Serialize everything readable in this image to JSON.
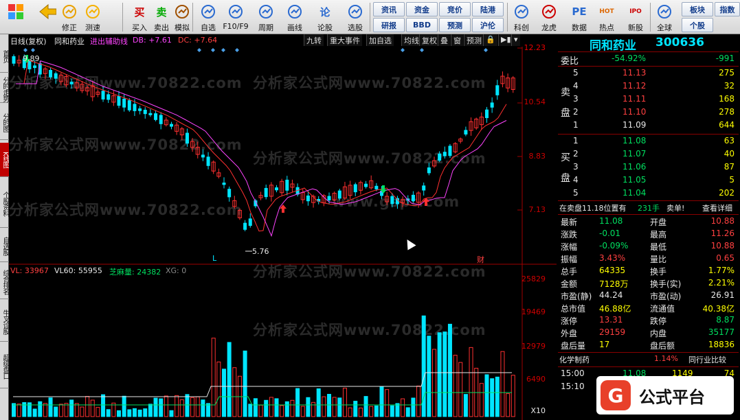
{
  "toolbar": {
    "items": [
      {
        "label": "",
        "icon": "grid-icon",
        "name": "toolbar-grid"
      },
      {
        "label": "",
        "icon": "back-arrow-icon",
        "name": "toolbar-back"
      },
      {
        "label": "修正",
        "icon": "up-down-icon",
        "name": "toolbar-fix"
      },
      {
        "label": "测速",
        "icon": "speed-icon",
        "name": "toolbar-speed"
      },
      {
        "label": "买入",
        "icon": "buy-icon",
        "glyph": "买",
        "name": "toolbar-buy"
      },
      {
        "label": "卖出",
        "icon": "sell-icon",
        "glyph": "卖",
        "name": "toolbar-sell"
      },
      {
        "label": "模拟",
        "icon": "hammer-icon",
        "name": "toolbar-simulate"
      },
      {
        "label": "自选",
        "icon": "star-list-icon",
        "name": "toolbar-watchlist"
      },
      {
        "label": "F10/F9",
        "icon": "f10-icon",
        "name": "toolbar-f10"
      },
      {
        "label": "周期",
        "icon": "clock-icon",
        "name": "toolbar-period"
      },
      {
        "label": "画线",
        "icon": "pencil-icon",
        "name": "toolbar-draw"
      },
      {
        "label": "论股",
        "icon": "discuss-icon",
        "glyph": "论",
        "name": "toolbar-discuss"
      },
      {
        "label": "选股",
        "icon": "select-stock-icon",
        "name": "toolbar-select"
      },
      {
        "label": "科创",
        "icon": "chart-icon",
        "name": "toolbar-star-market"
      },
      {
        "label": "龙虎",
        "icon": "dragon-icon",
        "name": "toolbar-dragon-tiger"
      },
      {
        "label": "数据",
        "icon": "pe-icon",
        "glyph": "PE",
        "name": "toolbar-data"
      },
      {
        "label": "热点",
        "icon": "hot-icon",
        "glyph": "HOT",
        "name": "toolbar-hot"
      },
      {
        "label": "新股",
        "icon": "ipo-icon",
        "glyph": "IPO",
        "name": "toolbar-ipo"
      },
      {
        "label": "全球",
        "icon": "globe-icon",
        "name": "toolbar-global"
      }
    ],
    "small_buttons": [
      "资讯",
      "资金",
      "竞价",
      "陆港",
      "研报",
      "BBD",
      "预测",
      "沪伦",
      "板块",
      "个股",
      "指数"
    ]
  },
  "left_tabs": [
    {
      "label": "首页",
      "active": false
    },
    {
      "label": "分时走势",
      "active": false
    },
    {
      "label": "分时图",
      "active": false
    },
    {
      "label": "K线图",
      "active": true
    },
    {
      "label": "个股资料",
      "active": false
    },
    {
      "label": "自选股",
      "active": false
    },
    {
      "label": "综合排名",
      "active": false
    },
    {
      "label": "牛叉诊股",
      "active": false
    },
    {
      "label": "超级盘口",
      "active": false
    }
  ],
  "chart": {
    "header": {
      "period": "日线(复权)",
      "stock": "同和药业",
      "indicator": "进出辅助线",
      "db": "DB: +7.61",
      "dc": "DC: +7.64"
    },
    "view_buttons": [
      "九转",
      "重大事件",
      "加自选",
      "均线",
      "复权",
      "叠",
      "窗",
      "预测"
    ],
    "y_labels": [
      "12.23",
      "10.54",
      "8.83",
      "7.13"
    ],
    "high_label": "9.89",
    "low_label": "5.76",
    "mark_L": "L",
    "mark_cai": "财",
    "vol_header": {
      "vl": "VL: 33967",
      "vl60": "VL60: 55955",
      "zhima": "芝麻量: 24382",
      "xg": "XG: 0"
    },
    "vol_labels": [
      "25829",
      "19469",
      "12979",
      "6490"
    ],
    "vol_unit": "X10",
    "watermarks": [
      "分析家公式网www.70822.com",
      "分析家公式网www.70822.com",
      "分析家公式网www.70822.com",
      "分析家公式网www.70822.com",
      "分析家公式网www.70822.com",
      "分析家公式网www.70822.com",
      "分析家公式网www.70822.com",
      "www.gspt.com"
    ]
  },
  "quote": {
    "name": "同和药业",
    "code": "300636",
    "weibi_label": "委比",
    "weibi": "-54.92%",
    "weicha": "-991",
    "sell_label": "卖盘",
    "buy_label": "买盘",
    "sell": [
      {
        "n": "5",
        "p": "11.13",
        "v": "275"
      },
      {
        "n": "4",
        "p": "11.12",
        "v": "32"
      },
      {
        "n": "3",
        "p": "11.11",
        "v": "168"
      },
      {
        "n": "2",
        "p": "11.10",
        "v": "278"
      },
      {
        "n": "1",
        "p": "11.09",
        "v": "644"
      }
    ],
    "buy": [
      {
        "n": "1",
        "p": "11.08",
        "v": "63"
      },
      {
        "n": "2",
        "p": "11.07",
        "v": "40"
      },
      {
        "n": "3",
        "p": "11.06",
        "v": "87"
      },
      {
        "n": "4",
        "p": "11.05",
        "v": "5"
      },
      {
        "n": "5",
        "p": "11.04",
        "v": "202"
      }
    ],
    "info_line": {
      "a": "在卖盘11.18位置有",
      "b": "231手",
      "c": "卖单!",
      "d": "查看详细"
    },
    "stats": [
      [
        "最新",
        "11.08",
        "开盘",
        "10.88"
      ],
      [
        "涨跌",
        "-0.01",
        "最高",
        "11.26"
      ],
      [
        "涨幅",
        "-0.09%",
        "最低",
        "10.88"
      ],
      [
        "振幅",
        "3.43%",
        "量比",
        "0.65"
      ],
      [
        "总手",
        "64335",
        "换手",
        "1.77%"
      ],
      [
        "金额",
        "7128万",
        "换手(实)",
        "2.21%"
      ],
      [
        "市盈(静)",
        "44.24",
        "市盈(动)",
        "26.91"
      ],
      [
        "总市值",
        "46.88亿",
        "流通值",
        "40.38亿"
      ],
      [
        "涨停",
        "13.31",
        "跌停",
        "8.87"
      ],
      [
        "外盘",
        "29159",
        "内盘",
        "35177"
      ],
      [
        "盘后量",
        "17",
        "盘后额",
        "18836"
      ]
    ],
    "industry": {
      "name": "化学制药",
      "pct": "1.14%",
      "link": "同行业比较"
    },
    "ticks": [
      {
        "t": "15:00",
        "p": "11.08",
        "v": "1149",
        "c": "74"
      },
      {
        "t": "15:10",
        "p": "",
        "v": "",
        "c": ""
      }
    ],
    "brand": "公式平台"
  }
}
